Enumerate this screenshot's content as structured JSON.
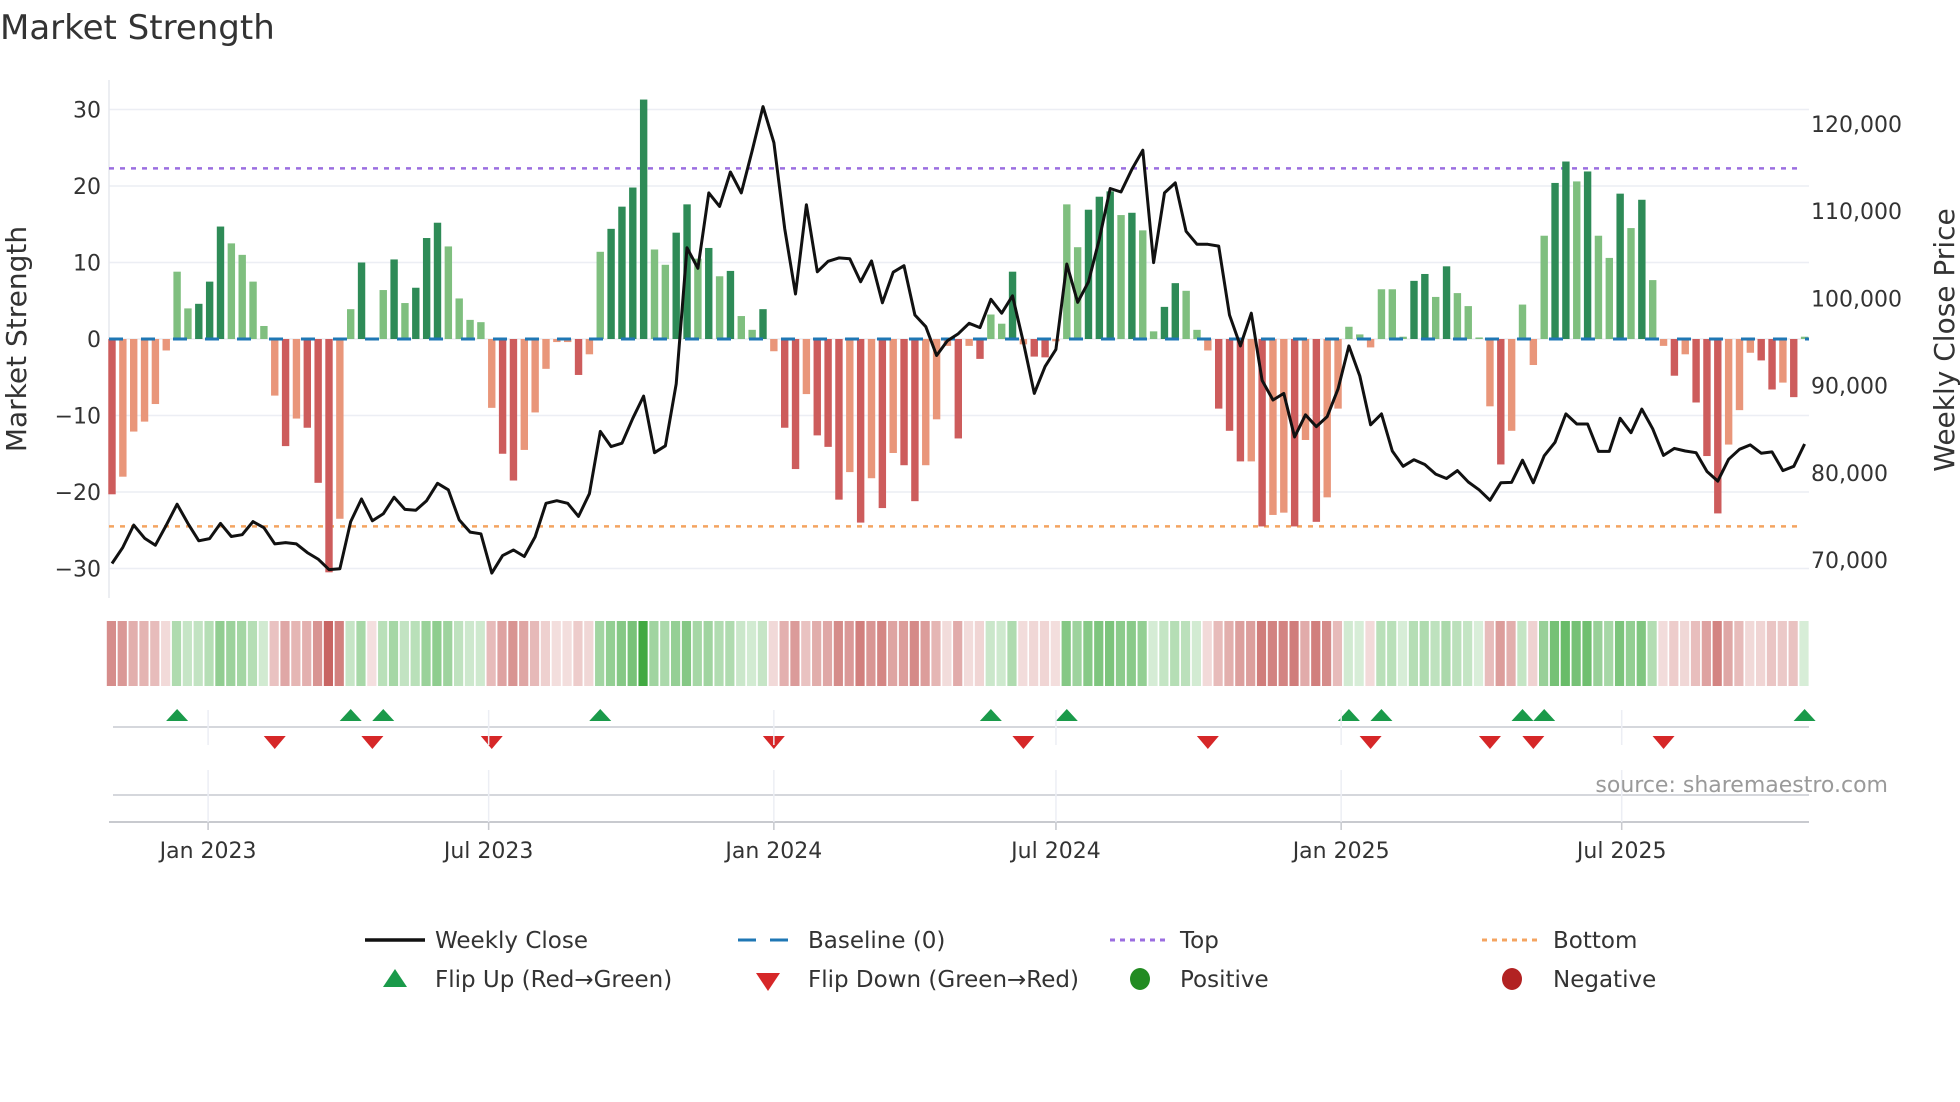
{
  "chart_data": {
    "type": "bar",
    "title": "Market Strength",
    "ylabel": "Market Strength",
    "y2label": "Weekly Close Price",
    "ylim": [
      -33,
      34
    ],
    "y2lim": [
      65000,
      124000
    ],
    "yticks": [
      "30",
      "20",
      "10",
      "0",
      "−10",
      "−20",
      "−30"
    ],
    "ytick_values": [
      30,
      20,
      10,
      0,
      -10,
      -20,
      -30
    ],
    "y2ticks": [
      "120,000",
      "110,000",
      "100,000",
      "90,000",
      "80,000",
      "70,000"
    ],
    "y2tick_values": [
      120000,
      110000,
      100000,
      90000,
      80000,
      70000
    ],
    "xticks": [
      "Jan 2023",
      "Jul 2023",
      "Jan 2024",
      "Jul 2024",
      "Jan 2025",
      "Jul 2025"
    ],
    "xtick_dates": [
      "2023-01-01",
      "2023-07-01",
      "2024-01-01",
      "2024-07-01",
      "2025-01-01",
      "2025-07-01"
    ],
    "start_date": "2022-10-31",
    "frequency": "weekly",
    "top_level": 22.3,
    "bottom_level": -24.5,
    "baseline": 0,
    "strength": [
      -20.3,
      -18,
      -12.1,
      -10.8,
      -8.5,
      -1.5,
      8.8,
      4,
      4.6,
      7.5,
      14.7,
      12.5,
      11,
      7.5,
      1.7,
      -7.4,
      -14,
      -10.4,
      -11.6,
      -18.8,
      -30.5,
      -23.5,
      3.9,
      10,
      -0.2,
      6.4,
      10.4,
      4.7,
      6.7,
      13.2,
      15.2,
      12.1,
      5.3,
      2.5,
      2.2,
      -9,
      -15,
      -18.5,
      -14.5,
      -9.6,
      -3.9,
      -0.4,
      -0.4,
      -4.7,
      -2,
      11.4,
      14.4,
      17.3,
      19.8,
      31.3,
      11.7,
      9.7,
      13.9,
      17.6,
      10.5,
      11.9,
      8.2,
      8.9,
      3,
      1.2,
      3.9,
      -1.6,
      -11.6,
      -17,
      -7.2,
      -12.6,
      -14.1,
      -21,
      -17.4,
      -24,
      -18.2,
      -22.1,
      -14.9,
      -16.5,
      -21.2,
      -16.5,
      -10.5,
      -0.9,
      -13,
      -0.9,
      -2.6,
      3.2,
      2,
      8.8,
      -0.7,
      -2.3,
      -2.4,
      -0.3,
      17.6,
      12,
      16.9,
      18.6,
      19.3,
      16.2,
      16.5,
      14.2,
      1,
      4.2,
      7.3,
      6.3,
      1.2,
      -1.5,
      -9.1,
      -12,
      -16,
      -16,
      -24.5,
      -23,
      -22.7,
      -24.5,
      -13.2,
      -23.9,
      -20.7,
      -9.1,
      1.6,
      0.6,
      -1.1,
      6.5,
      6.5,
      0.3,
      7.6,
      8.5,
      5.5,
      9.5,
      6,
      4.3,
      0.2,
      -8.8,
      -16.4,
      -12,
      4.5,
      -3.4,
      13.5,
      20.4,
      23.2,
      20.6,
      21.9,
      13.5,
      10.6,
      19,
      14.5,
      18.2,
      7.7,
      -0.9,
      -4.8,
      -2,
      -8.3,
      -15.3,
      -22.8,
      -13.8,
      -9.3,
      -1.8,
      -2.8,
      -6.6,
      -5.7,
      -7.6,
      0.3
    ],
    "weekly_close": [
      69600,
      71450,
      74000,
      72500,
      71700,
      74000,
      76400,
      74200,
      72200,
      72450,
      74200,
      72700,
      72900,
      74400,
      73700,
      71850,
      72000,
      71850,
      70850,
      70100,
      68900,
      69000,
      74400,
      77000,
      74500,
      75300,
      77200,
      75800,
      75700,
      76800,
      78800,
      78050,
      74600,
      73200,
      73000,
      68500,
      70500,
      71150,
      70400,
      72650,
      76500,
      76800,
      76500,
      75000,
      77600,
      84750,
      83000,
      83400,
      86250,
      88800,
      82300,
      83100,
      90200,
      105800,
      103450,
      112100,
      110550,
      114500,
      112100,
      116900,
      122000,
      117850,
      108000,
      100500,
      110750,
      103050,
      104250,
      104650,
      104550,
      101900,
      104300,
      99500,
      103000,
      103750,
      98100,
      96750,
      93450,
      95150,
      95950,
      97150,
      96650,
      99900,
      98300,
      100300,
      94950,
      89100,
      92200,
      94150,
      103950,
      99550,
      101900,
      106800,
      112600,
      112200,
      114800,
      117000,
      104100,
      112100,
      113250,
      107700,
      106200,
      106200,
      106000,
      98100,
      94550,
      98300,
      90600,
      88350,
      89100,
      84100,
      86650,
      85300,
      86450,
      89600,
      94550,
      91100,
      85500,
      86750,
      82500,
      80750,
      81500,
      80950,
      79850,
      79350,
      80250,
      78950,
      78050,
      76850,
      78850,
      78900,
      81450,
      78850,
      81950,
      83500,
      86750,
      85600,
      85600,
      82450,
      82450,
      86250,
      84600,
      87300,
      85050,
      82000,
      82800,
      82500,
      82300,
      80150,
      79050,
      81550,
      82700,
      83200,
      82250,
      82400,
      80250,
      80750,
      83300
    ],
    "flip_up_weeks": [
      6,
      22,
      25,
      45,
      81,
      88,
      114,
      117,
      130,
      132,
      156
    ],
    "flip_down_weeks": [
      15,
      24,
      35,
      61,
      84,
      101,
      116,
      127,
      131,
      143
    ],
    "legend": [
      {
        "label": "Weekly Close",
        "kind": "line",
        "color": "#111111"
      },
      {
        "label": "Baseline (0)",
        "kind": "dash",
        "color": "#1f77b4"
      },
      {
        "label": "Top",
        "kind": "dot",
        "color": "#9b6ee0"
      },
      {
        "label": "Bottom",
        "kind": "dot",
        "color": "#f4a460"
      },
      {
        "label": "Flip Up (Red→Green)",
        "kind": "triangle-up",
        "color": "#1a9a4a"
      },
      {
        "label": "Flip Down (Green→Red)",
        "kind": "triangle-down",
        "color": "#d62728"
      },
      {
        "label": "Positive",
        "kind": "circle",
        "color": "#228b22"
      },
      {
        "label": "Negative",
        "kind": "circle",
        "color": "#b22222"
      }
    ],
    "legend_position": "bottom",
    "grid": true,
    "colors": {
      "pos_strong": "#2e8b57",
      "pos_weak": "#7fbf7f",
      "neg_strong": "#cd5c5c",
      "neg_weak": "#e9967a",
      "heat_pos": "#2ca02c",
      "heat_neg": "#c0504d"
    }
  },
  "source": "source: sharemaestro.com"
}
